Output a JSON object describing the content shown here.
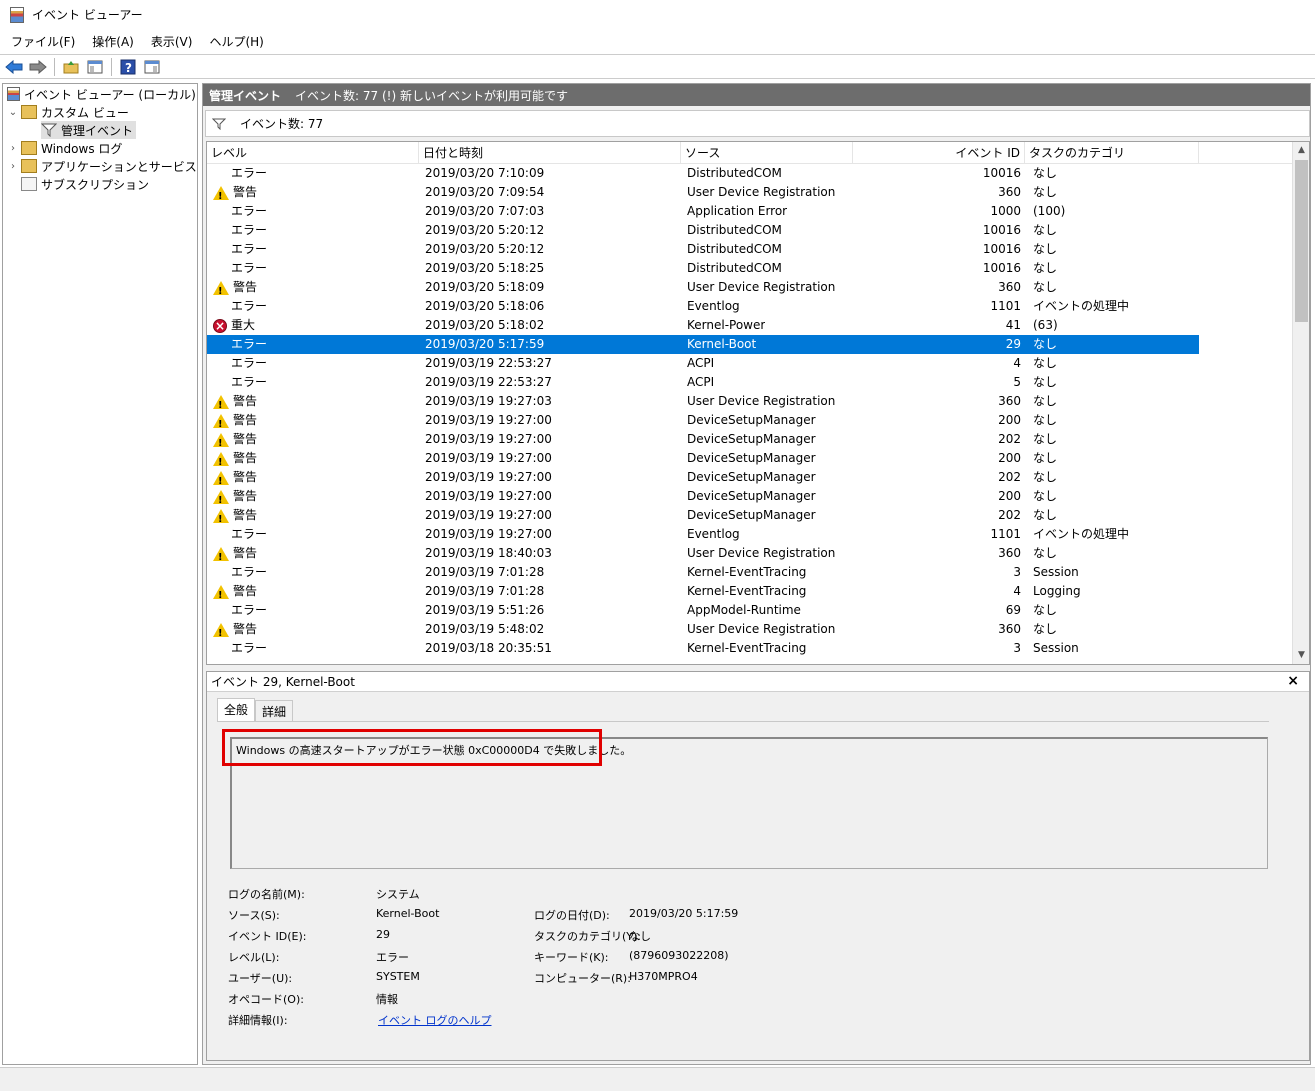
{
  "window": {
    "title": "イベント ビューアー"
  },
  "menu": [
    "ファイル(F)",
    "操作(A)",
    "表示(V)",
    "ヘルプ(H)"
  ],
  "tree": {
    "root": "イベント ビューアー (ローカル)",
    "custom_view": "カスタム ビュー",
    "admin_events": "管理イベント",
    "windows_logs": "Windows ログ",
    "app_service_logs": "アプリケーションとサービス ログ",
    "subscriptions": "サブスクリプション"
  },
  "main_header": {
    "title": "管理イベント",
    "info": "イベント数: 77 (!) 新しいイベントが利用可能です"
  },
  "filter": {
    "text": "イベント数: 77"
  },
  "columns": {
    "level": "レベル",
    "date": "日付と時刻",
    "source": "ソース",
    "id": "イベント ID",
    "category": "タスクのカテゴリ"
  },
  "events": [
    {
      "type": "error",
      "level": "エラー",
      "date": "2019/03/20 7:10:09",
      "source": "DistributedCOM",
      "id": "10016",
      "category": "なし"
    },
    {
      "type": "warn",
      "level": "警告",
      "date": "2019/03/20 7:09:54",
      "source": "User Device Registration",
      "id": "360",
      "category": "なし"
    },
    {
      "type": "error",
      "level": "エラー",
      "date": "2019/03/20 7:07:03",
      "source": "Application Error",
      "id": "1000",
      "category": "(100)"
    },
    {
      "type": "error",
      "level": "エラー",
      "date": "2019/03/20 5:20:12",
      "source": "DistributedCOM",
      "id": "10016",
      "category": "なし"
    },
    {
      "type": "error",
      "level": "エラー",
      "date": "2019/03/20 5:20:12",
      "source": "DistributedCOM",
      "id": "10016",
      "category": "なし"
    },
    {
      "type": "error",
      "level": "エラー",
      "date": "2019/03/20 5:18:25",
      "source": "DistributedCOM",
      "id": "10016",
      "category": "なし"
    },
    {
      "type": "warn",
      "level": "警告",
      "date": "2019/03/20 5:18:09",
      "source": "User Device Registration",
      "id": "360",
      "category": "なし"
    },
    {
      "type": "error",
      "level": "エラー",
      "date": "2019/03/20 5:18:06",
      "source": "Eventlog",
      "id": "1101",
      "category": "イベントの処理中"
    },
    {
      "type": "crit",
      "level": "重大",
      "date": "2019/03/20 5:18:02",
      "source": "Kernel-Power",
      "id": "41",
      "category": "(63)"
    },
    {
      "type": "error",
      "level": "エラー",
      "date": "2019/03/20 5:17:59",
      "source": "Kernel-Boot",
      "id": "29",
      "category": "なし",
      "selected": true
    },
    {
      "type": "error",
      "level": "エラー",
      "date": "2019/03/19 22:53:27",
      "source": "ACPI",
      "id": "4",
      "category": "なし"
    },
    {
      "type": "error",
      "level": "エラー",
      "date": "2019/03/19 22:53:27",
      "source": "ACPI",
      "id": "5",
      "category": "なし"
    },
    {
      "type": "warn",
      "level": "警告",
      "date": "2019/03/19 19:27:03",
      "source": "User Device Registration",
      "id": "360",
      "category": "なし"
    },
    {
      "type": "warn",
      "level": "警告",
      "date": "2019/03/19 19:27:00",
      "source": "DeviceSetupManager",
      "id": "200",
      "category": "なし"
    },
    {
      "type": "warn",
      "level": "警告",
      "date": "2019/03/19 19:27:00",
      "source": "DeviceSetupManager",
      "id": "202",
      "category": "なし"
    },
    {
      "type": "warn",
      "level": "警告",
      "date": "2019/03/19 19:27:00",
      "source": "DeviceSetupManager",
      "id": "200",
      "category": "なし"
    },
    {
      "type": "warn",
      "level": "警告",
      "date": "2019/03/19 19:27:00",
      "source": "DeviceSetupManager",
      "id": "202",
      "category": "なし"
    },
    {
      "type": "warn",
      "level": "警告",
      "date": "2019/03/19 19:27:00",
      "source": "DeviceSetupManager",
      "id": "200",
      "category": "なし"
    },
    {
      "type": "warn",
      "level": "警告",
      "date": "2019/03/19 19:27:00",
      "source": "DeviceSetupManager",
      "id": "202",
      "category": "なし"
    },
    {
      "type": "error",
      "level": "エラー",
      "date": "2019/03/19 19:27:00",
      "source": "Eventlog",
      "id": "1101",
      "category": "イベントの処理中"
    },
    {
      "type": "warn",
      "level": "警告",
      "date": "2019/03/19 18:40:03",
      "source": "User Device Registration",
      "id": "360",
      "category": "なし"
    },
    {
      "type": "error",
      "level": "エラー",
      "date": "2019/03/19 7:01:28",
      "source": "Kernel-EventTracing",
      "id": "3",
      "category": "Session"
    },
    {
      "type": "warn",
      "level": "警告",
      "date": "2019/03/19 7:01:28",
      "source": "Kernel-EventTracing",
      "id": "4",
      "category": "Logging"
    },
    {
      "type": "error",
      "level": "エラー",
      "date": "2019/03/19 5:51:26",
      "source": "AppModel-Runtime",
      "id": "69",
      "category": "なし"
    },
    {
      "type": "warn",
      "level": "警告",
      "date": "2019/03/19 5:48:02",
      "source": "User Device Registration",
      "id": "360",
      "category": "なし"
    },
    {
      "type": "error",
      "level": "エラー",
      "date": "2019/03/18 20:35:51",
      "source": "Kernel-EventTracing",
      "id": "3",
      "category": "Session"
    }
  ],
  "detail": {
    "title": "イベント 29, Kernel-Boot",
    "tabs": [
      "全般",
      "詳細"
    ],
    "description": "Windows の高速スタートアップがエラー状態 0xC00000D4 で失敗しました。",
    "labels": {
      "log_name": "ログの名前(M):",
      "source": "ソース(S):",
      "event_id": "イベント ID(E):",
      "level": "レベル(L):",
      "user": "ユーザー(U):",
      "opcode": "オペコード(O):",
      "more_info": "詳細情報(I):",
      "logged": "ログの日付(D):",
      "task_category": "タスクのカテゴリ(Y):",
      "keywords": "キーワード(K):",
      "computer": "コンピューター(R):"
    },
    "values": {
      "log_name": "システム",
      "source": "Kernel-Boot",
      "event_id": "29",
      "level": "エラー",
      "user": "SYSTEM",
      "opcode": "情報",
      "more_info": "イベント ログのヘルプ",
      "logged": "2019/03/20 5:17:59",
      "task_category": "なし",
      "keywords": "(8796093022208)",
      "computer": "H370MPRO4"
    }
  },
  "colors": {
    "selection": "#0078d7",
    "header": "#6d6d6d",
    "highlight_box": "#e00000"
  }
}
